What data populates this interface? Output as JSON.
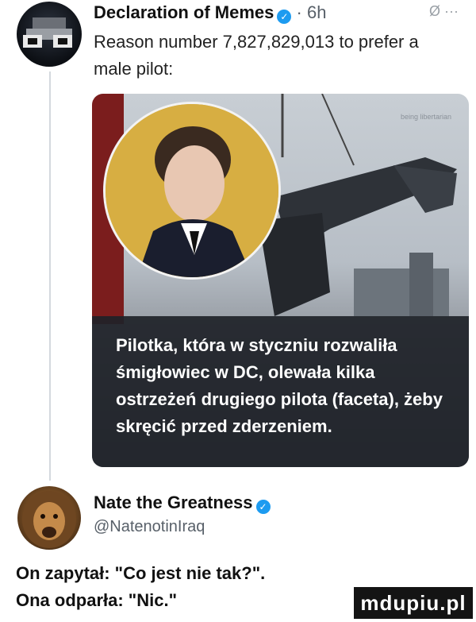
{
  "tweet1": {
    "author": "Declaration of Memes",
    "verified_icon": "check-badge-icon",
    "time": "6h",
    "text": "Reason number 7,827,829,013 to prefer a male pilot:"
  },
  "menu": {
    "no_retweet_icon": "Ø",
    "more_icon": "···"
  },
  "card": {
    "watermark": "being libertarian",
    "caption": "Pilotka, która w styczniu rozwaliła śmigłowiec w DC, olewała kilka ostrzeżeń drugiego pilota (faceta), żeby skręcić przed zderzeniem."
  },
  "tweet2": {
    "author": "Nate the Greatness",
    "handle": "@NatenotinIraq"
  },
  "bottom": {
    "line1": "On zapytał: \"Co jest nie tak?\".",
    "line2": "Ona odparła: \"Nic.\""
  },
  "site_badge": "mdupiu.pl",
  "colors": {
    "verified": "#1d9bf0",
    "caption_bg": "#1e2228"
  }
}
